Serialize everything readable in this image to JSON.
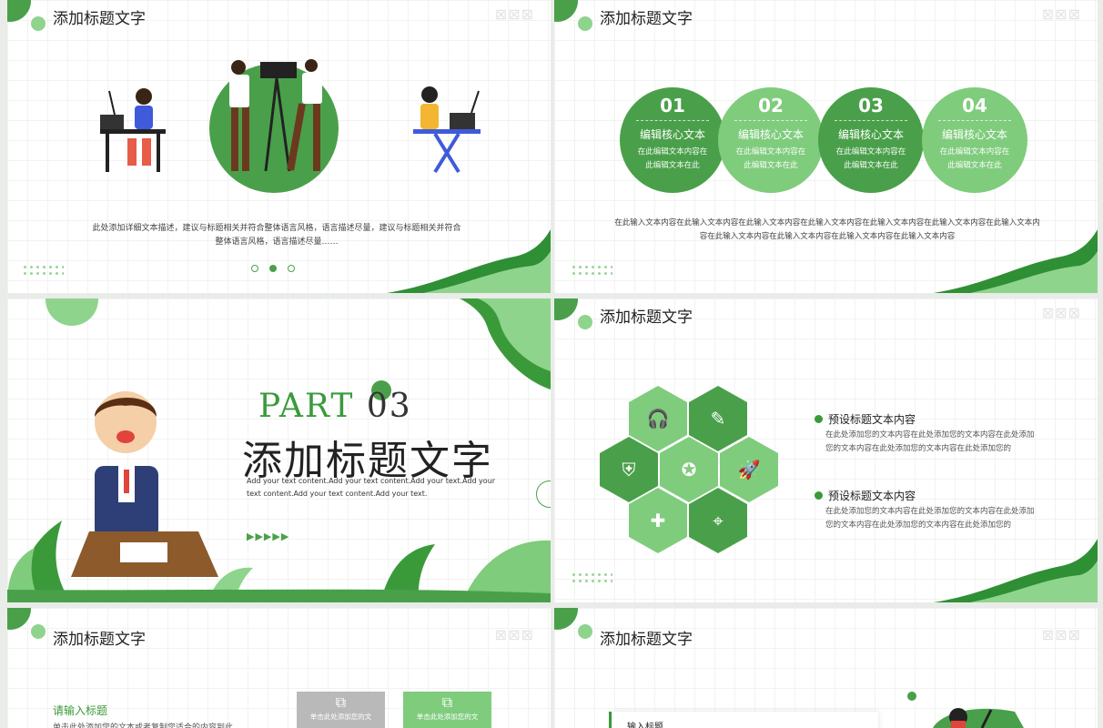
{
  "slide_title": "添加标题文字",
  "slide1": {
    "description": "此处添加详细文本描述，建议与标题相关并符合整体语言风格，语言描述尽量，建议与标题相关并符合整体语言风格，语言描述尽量……"
  },
  "slide2": {
    "circles": [
      {
        "num": "01",
        "head": "编辑核心文本",
        "sub1": "在此编辑文本内容在",
        "sub2": "此编辑文本在此",
        "color": "#4aa04a"
      },
      {
        "num": "02",
        "head": "编辑核心文本",
        "sub1": "在此编辑文本内容在",
        "sub2": "此编辑文本在此",
        "color": "#7fcc7d"
      },
      {
        "num": "03",
        "head": "编辑核心文本",
        "sub1": "在此编辑文本内容在",
        "sub2": "此编辑文本在此",
        "color": "#4aa04a"
      },
      {
        "num": "04",
        "head": "编辑核心文本",
        "sub1": "在此编辑文本内容在",
        "sub2": "此编辑文本在此",
        "color": "#7fcc7d"
      }
    ],
    "text_line1": "在此输入文本内容在此输入文本内容在此输入文本内容在此输入文本内容在此输入文本内容在此输入文本内容在此输入文本内",
    "text_line2": "容在此输入文本内容在此输入文本内容在此输入文本内容在此输入文本内容"
  },
  "slide3": {
    "part_label": "PART",
    "part_num": "03",
    "title": "添加标题文字",
    "en_text": "Add your text content.Add your text content.Add your text.Add your text content.Add your text content.Add your text.",
    "arrows": "▶▶▶▶▶"
  },
  "slide4": {
    "items": [
      {
        "title": "预设标题文本内容",
        "line1": "在此处添加您的文本内容在此处添加您的文本内容在此处添加",
        "line2": "您的文本内容在此处添加您的文本内容在此处添加您的"
      },
      {
        "title": "预设标题文本内容",
        "line1": "在此处添加您的文本内容在此处添加您的文本内容在此处添加",
        "line2": "您的文本内容在此处添加您的文本内容在此处添加您的"
      }
    ],
    "hex_icons": [
      "headset-icon",
      "pen-icon",
      "shield-icon",
      "award-icon",
      "rocket-icon",
      "puzzle-icon",
      "location-icon"
    ]
  },
  "slide5": {
    "heading": "请输入标题",
    "subtext": "单击此处添加您的文本或者复制您适合的内容到此",
    "cards": [
      {
        "label": "单击此处添加您的文",
        "color": "#b9b9b9"
      },
      {
        "label": "单击此处添加您的文",
        "color": "#7fcc7d"
      }
    ]
  },
  "slide6": {
    "label": "输入标题"
  },
  "colors": {
    "green_dark": "#4aa04a",
    "green_light": "#7fcc7d",
    "green_pale": "#bfe8bd"
  }
}
